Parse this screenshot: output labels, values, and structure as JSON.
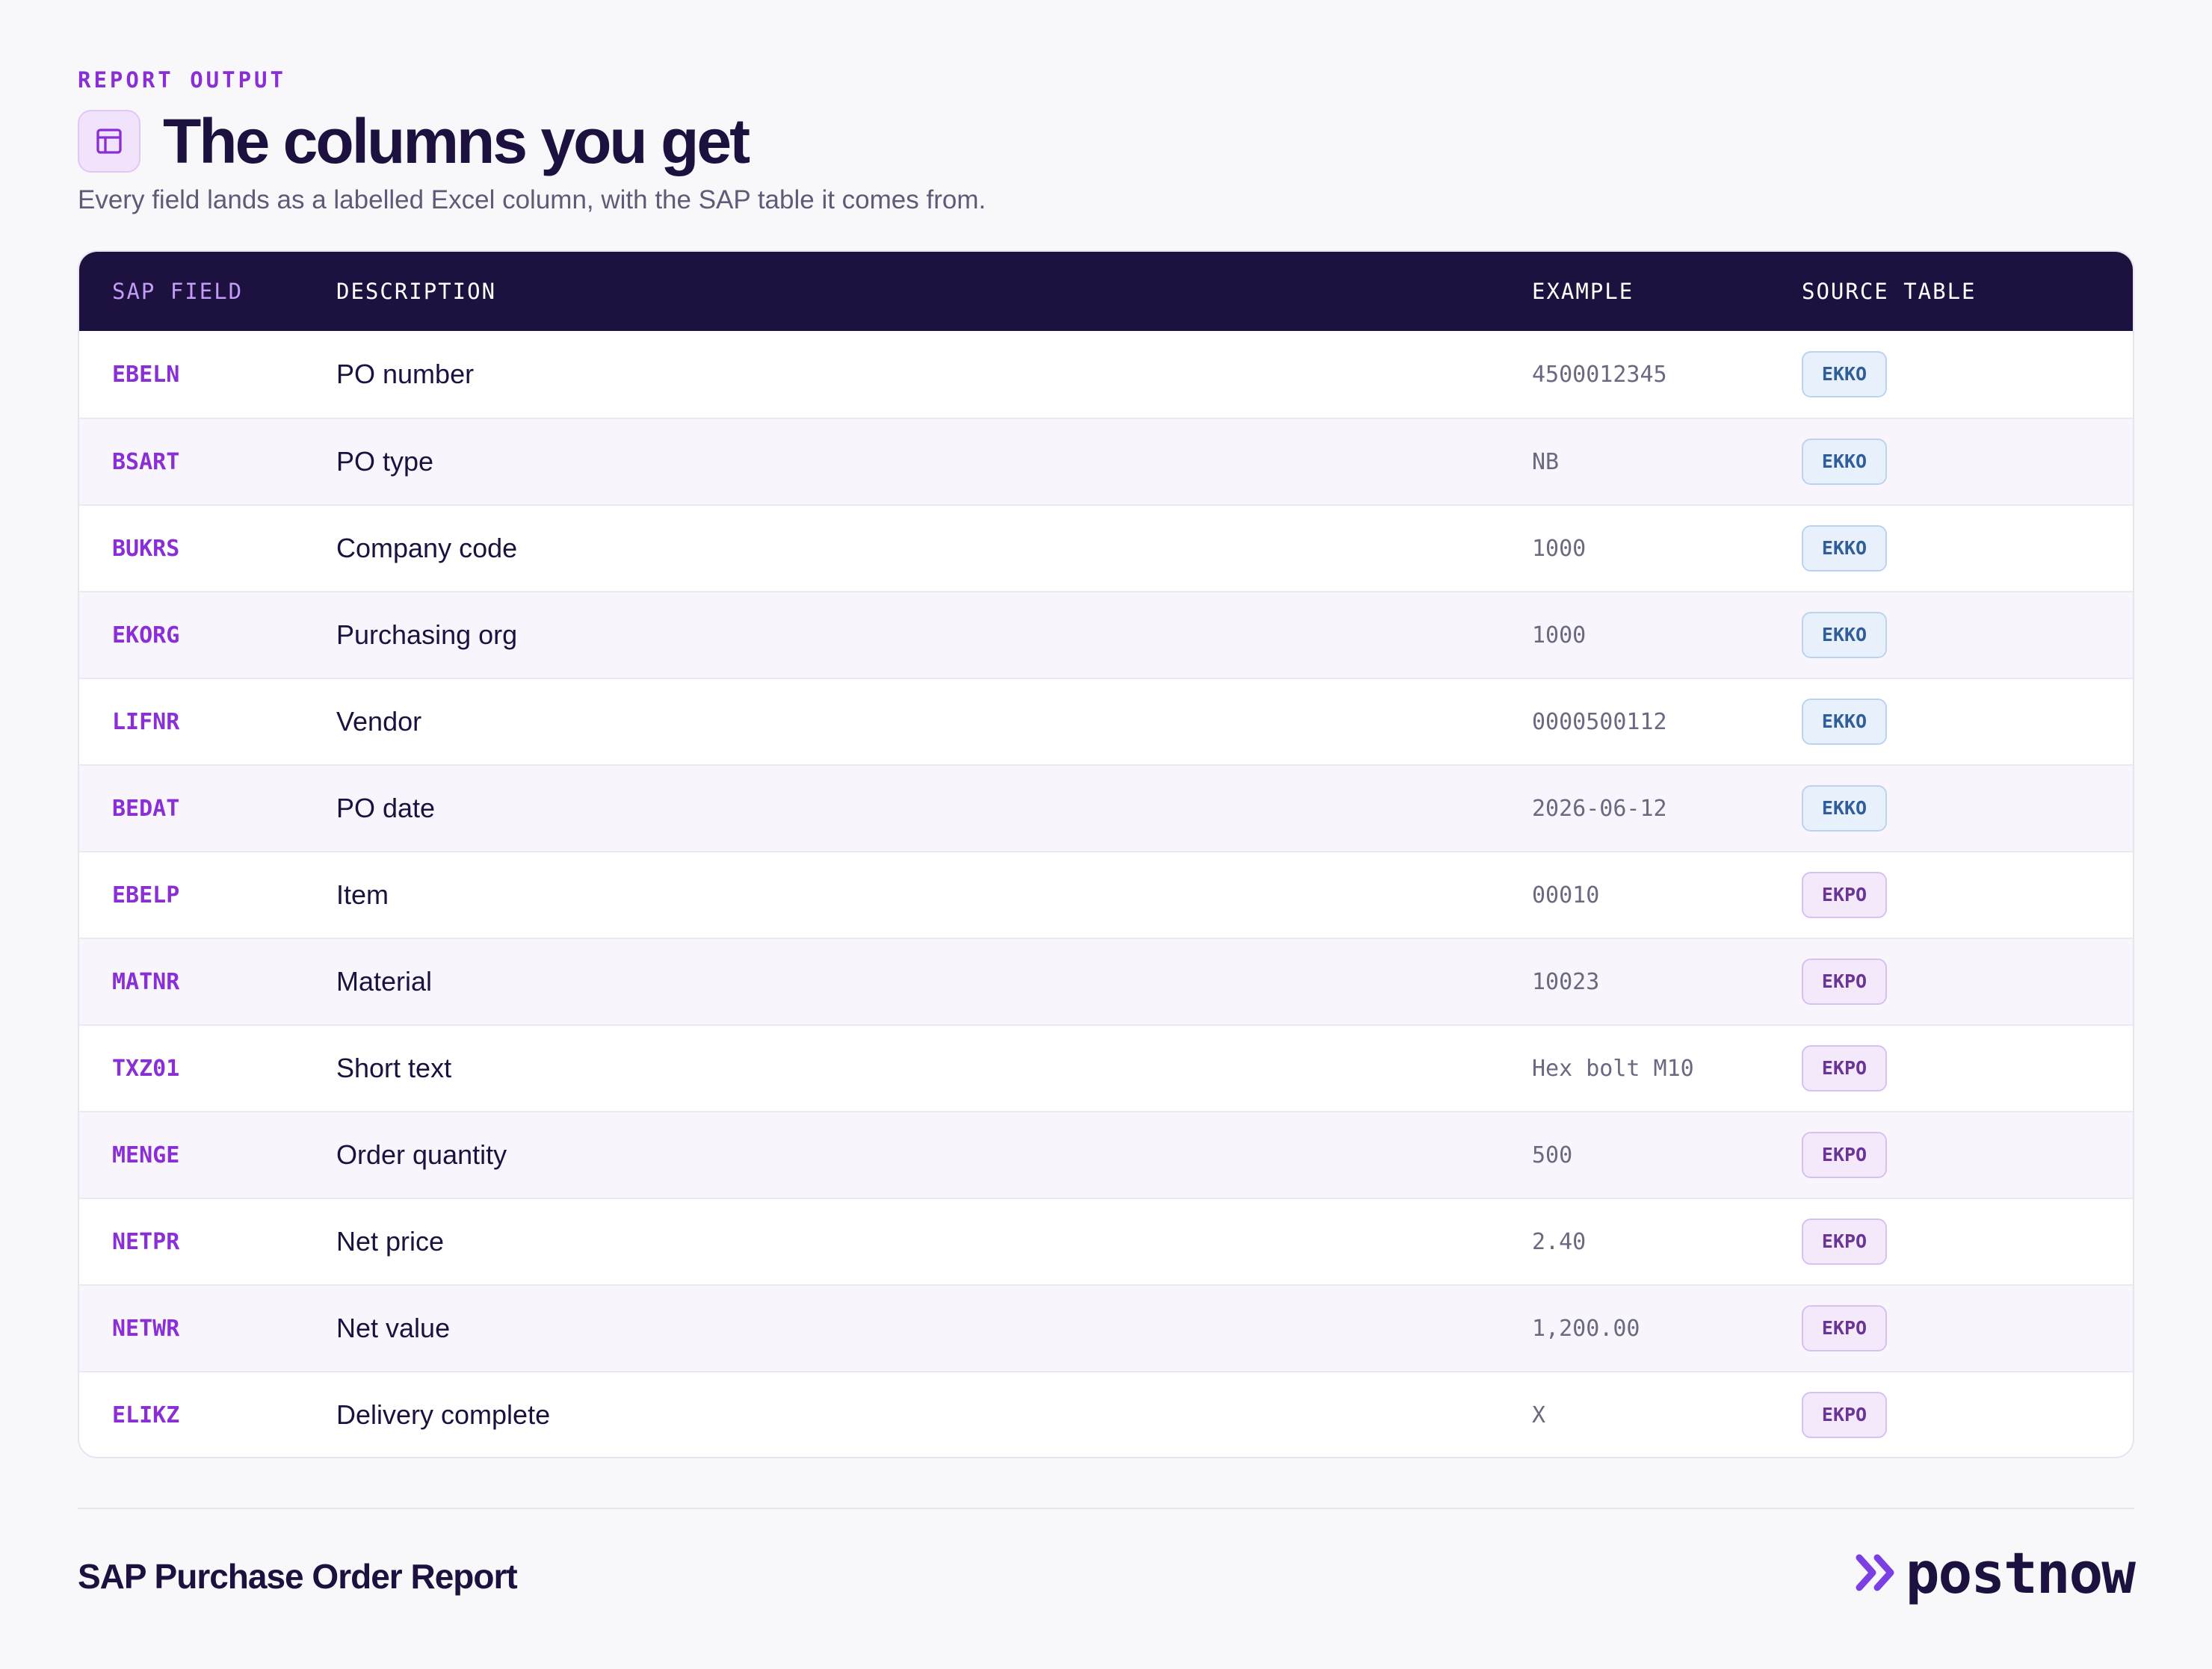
{
  "header": {
    "eyebrow": "REPORT OUTPUT",
    "title": "The columns you get",
    "subtitle": "Every field lands as a labelled Excel column, with the SAP table it comes from.",
    "icon": "table-layout-icon"
  },
  "table": {
    "columns": [
      "SAP FIELD",
      "DESCRIPTION",
      "EXAMPLE",
      "SOURCE TABLE"
    ],
    "rows": [
      {
        "field": "EBELN",
        "description": "PO number",
        "example": "4500012345",
        "source": "EKKO"
      },
      {
        "field": "BSART",
        "description": "PO type",
        "example": "NB",
        "source": "EKKO"
      },
      {
        "field": "BUKRS",
        "description": "Company code",
        "example": "1000",
        "source": "EKKO"
      },
      {
        "field": "EKORG",
        "description": "Purchasing org",
        "example": "1000",
        "source": "EKKO"
      },
      {
        "field": "LIFNR",
        "description": "Vendor",
        "example": "0000500112",
        "source": "EKKO"
      },
      {
        "field": "BEDAT",
        "description": "PO date",
        "example": "2026-06-12",
        "source": "EKKO"
      },
      {
        "field": "EBELP",
        "description": "Item",
        "example": "00010",
        "source": "EKPO"
      },
      {
        "field": "MATNR",
        "description": "Material",
        "example": "10023",
        "source": "EKPO"
      },
      {
        "field": "TXZ01",
        "description": "Short text",
        "example": "Hex bolt M10",
        "source": "EKPO"
      },
      {
        "field": "MENGE",
        "description": "Order quantity",
        "example": "500",
        "source": "EKPO"
      },
      {
        "field": "NETPR",
        "description": "Net price",
        "example": "2.40",
        "source": "EKPO"
      },
      {
        "field": "NETWR",
        "description": "Net value",
        "example": "1,200.00",
        "source": "EKPO"
      },
      {
        "field": "ELIKZ",
        "description": "Delivery complete",
        "example": "X",
        "source": "EKPO"
      }
    ]
  },
  "footer": {
    "report_name": "SAP Purchase Order Report",
    "brand": "postnow",
    "brand_icon": "double-chevron-right-icon"
  },
  "colors": {
    "accent": "#8a2fd6",
    "header_bg": "#1d1140",
    "ekko_badge": "#e8f1fb",
    "ekpo_badge": "#f3e9fb"
  }
}
